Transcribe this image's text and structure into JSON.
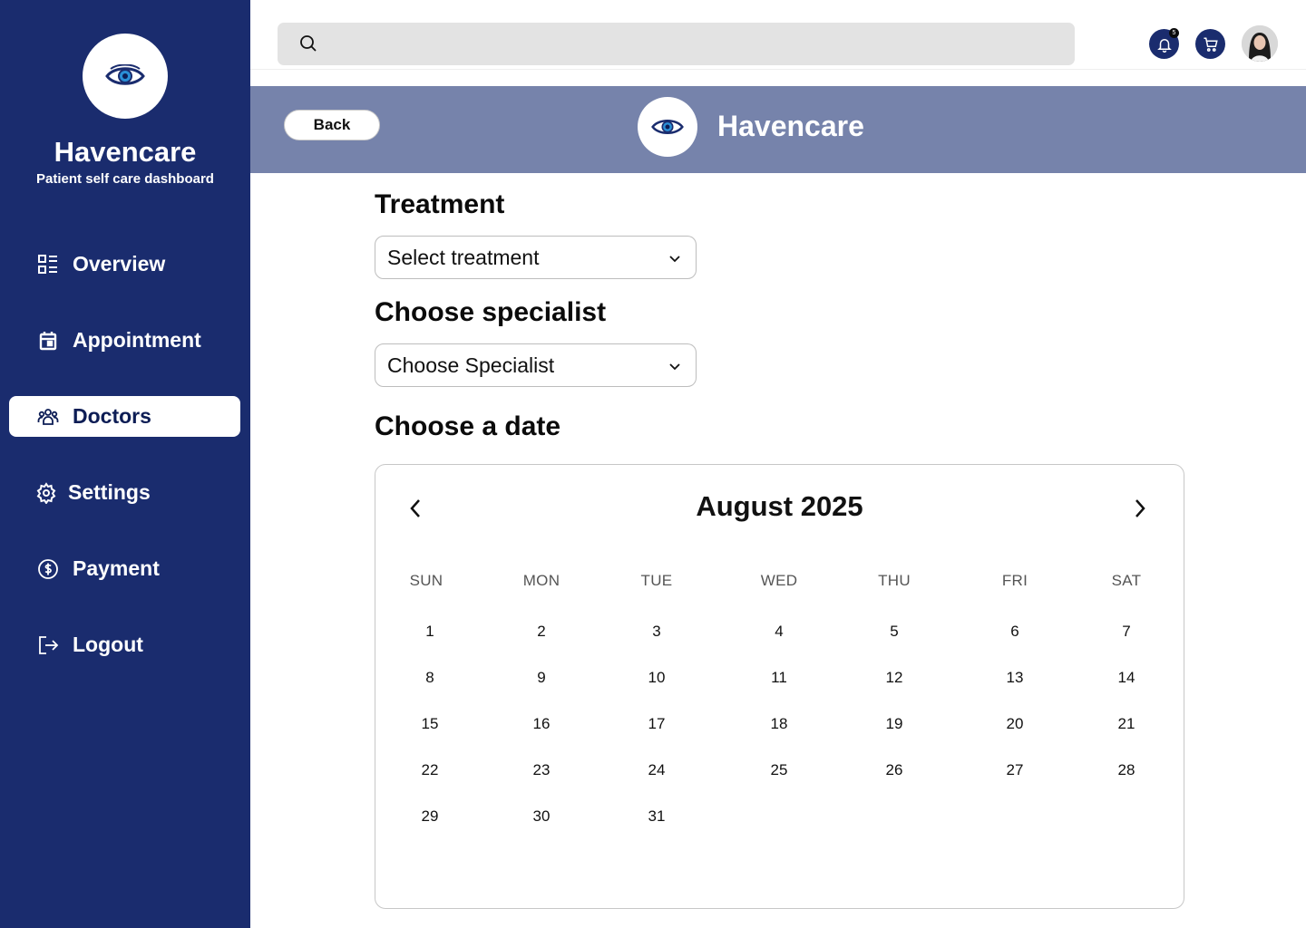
{
  "brand": {
    "name": "Havencare",
    "subtitle": "Patient self care dashboard"
  },
  "sidebar": {
    "items": [
      {
        "label": "Overview",
        "icon": "grid-list-icon",
        "active": false
      },
      {
        "label": "Appointment",
        "icon": "calendar-icon",
        "active": false
      },
      {
        "label": "Doctors",
        "icon": "people-icon",
        "active": true
      },
      {
        "label": "Settings",
        "icon": "gear-icon",
        "active": false
      },
      {
        "label": "Payment",
        "icon": "dollar-circle-icon",
        "active": false
      },
      {
        "label": "Logout",
        "icon": "logout-icon",
        "active": false
      }
    ]
  },
  "topbar": {
    "search": {
      "value": "",
      "placeholder": ""
    },
    "notifications_count": "5"
  },
  "banner": {
    "back_label": "Back",
    "title": "Havencare"
  },
  "form": {
    "treatment": {
      "label": "Treatment",
      "value": "Select treatment"
    },
    "specialist": {
      "label": "Choose specialist",
      "value": "Choose Specialist"
    },
    "date": {
      "label": "Choose a date"
    }
  },
  "calendar": {
    "title": "August 2025",
    "weekdays": [
      "SUN",
      "MON",
      "TUE",
      "WED",
      "THU",
      "FRI",
      "SAT"
    ],
    "weeks": [
      [
        "1",
        "2",
        "3",
        "4",
        "5",
        "6",
        "7"
      ],
      [
        "8",
        "9",
        "10",
        "11",
        "12",
        "13",
        "14"
      ],
      [
        "15",
        "16",
        "17",
        "18",
        "19",
        "20",
        "21"
      ],
      [
        "22",
        "23",
        "24",
        "25",
        "26",
        "27",
        "28"
      ],
      [
        "29",
        "30",
        "31",
        "",
        "",
        "",
        ""
      ]
    ]
  },
  "colors": {
    "sidebar": "#1a2c6e",
    "banner": "#7683ab",
    "accent": "#1a2c6e"
  }
}
